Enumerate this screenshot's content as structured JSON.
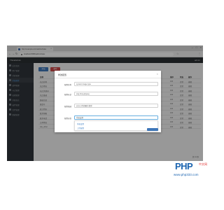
{
  "browser": {
    "tab_title": "http://example.com/admin/index",
    "url": "localhost:8080/admin/index",
    "icons": {
      "back": "←",
      "forward": "→",
      "reload": "↻",
      "star": "☆",
      "menu": "⋮",
      "tab_close": "×",
      "win_min": "–",
      "win_max": "□",
      "win_close": "×"
    }
  },
  "app": {
    "brand": "ThinkAdmin",
    "user": "admin"
  },
  "sidebar": {
    "items": [
      {
        "label": "后台首页",
        "active": false
      },
      {
        "label": "用户管理",
        "active": false
      },
      {
        "label": "系统管理",
        "active": false
      },
      {
        "label": "系统配置",
        "active": true
      },
      {
        "label": "菜单管理",
        "active": false
      },
      {
        "label": "节点管理",
        "active": false
      },
      {
        "label": "权限管理",
        "active": false
      },
      {
        "label": "系统日志",
        "active": false
      },
      {
        "label": "插件管理",
        "active": false
      },
      {
        "label": "文件管理",
        "active": false
      },
      {
        "label": "数据管理",
        "active": false
      }
    ]
  },
  "toolbar": {
    "add_label": "添加",
    "delete_label": "删除"
  },
  "table": {
    "headers": [
      "名称",
      "标识",
      "值",
      "排序",
      "状态",
      "操作"
    ],
    "rows": [
      [
        "站点名称",
        "site_name",
        "ThinkAdmin",
        "100",
        "正常",
        "编辑"
      ],
      [
        "站点地址",
        "site_url",
        "http://www.example.com",
        "100",
        "正常",
        "编辑"
      ],
      [
        "站点关键词",
        "site_keywords",
        "ThinkAdmin",
        "100",
        "正常",
        "编辑"
      ],
      [
        "站点描述",
        "site_desc",
        "后台管理系统",
        "100",
        "正常",
        "编辑"
      ],
      [
        "版权信息",
        "site_copy",
        "Copyright",
        "100",
        "正常",
        "编辑"
      ],
      [
        "备案号",
        "site_icp",
        "",
        "100",
        "正常",
        "编辑"
      ],
      [
        "统计代码",
        "site_count",
        "",
        "100",
        "正常",
        "编辑"
      ],
      [
        "联系邮箱",
        "site_email",
        "admin@example.com",
        "100",
        "正常",
        "编辑"
      ],
      [
        "联系电话",
        "site_phone",
        "",
        "100",
        "正常",
        "编辑"
      ],
      [
        "公司地址",
        "site_address",
        "",
        "100",
        "正常",
        "编辑"
      ],
      [
        "site_other",
        "site_other",
        "<a href=\"javascript:;\"></a>",
        "100",
        "正常",
        "编辑"
      ]
    ],
    "pager": "共 11 条"
  },
  "modal": {
    "title": "修改配置",
    "close_icon": "×",
    "fields": [
      {
        "label": "配置名称",
        "value": "system.image.type"
      },
      {
        "label": "配置标识",
        "value": "png,bmp,gif,jpeg"
      },
      {
        "label": "配置描述",
        "value": "允许上传的图片类型"
      },
      {
        "label": "配置分组",
        "value": "系统设置"
      }
    ],
    "dropdown_options": [
      "系统设置",
      "上传配置"
    ]
  },
  "watermark": {
    "logo_text": "PHP",
    "suffix": "中文网",
    "url": "www.php333.com"
  }
}
